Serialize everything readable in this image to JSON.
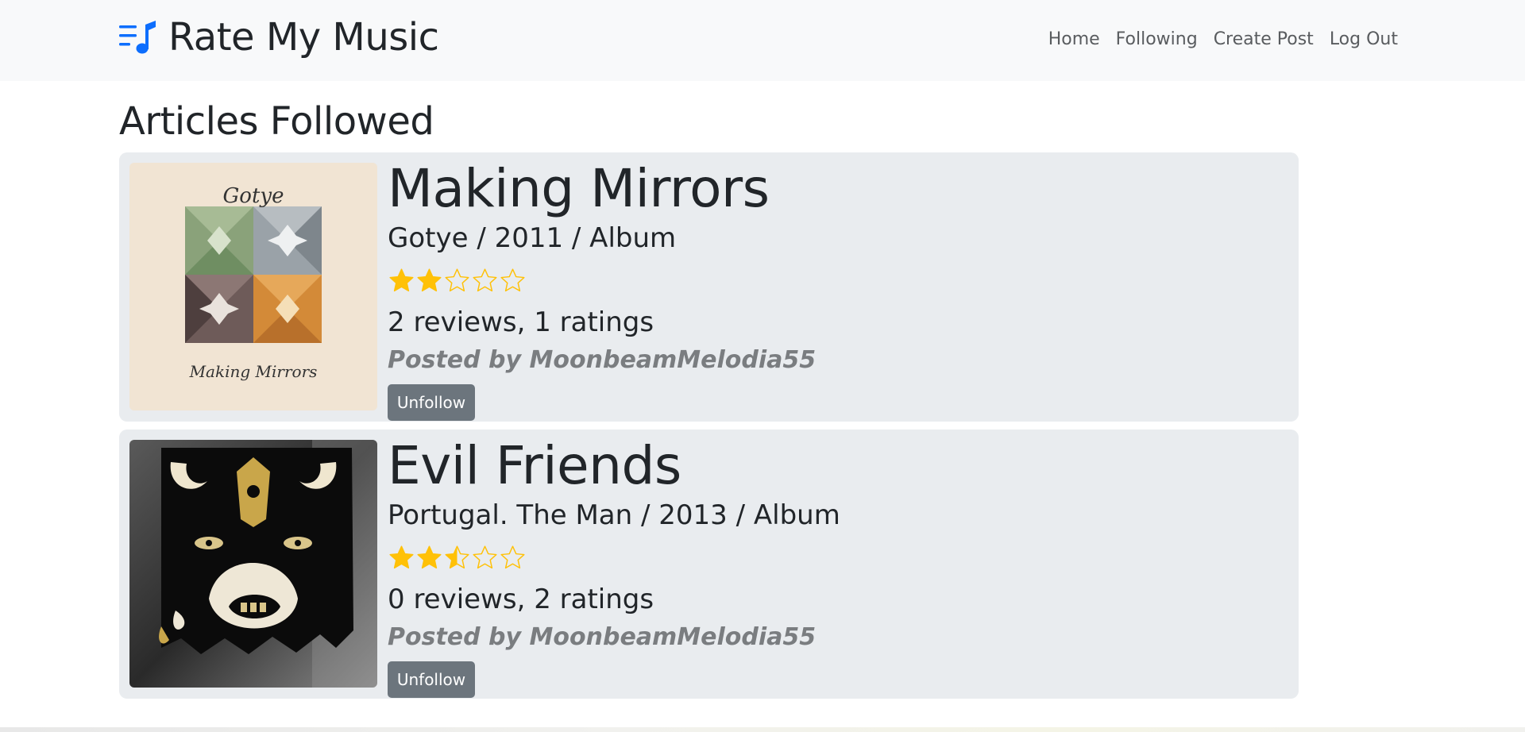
{
  "brand": {
    "name": "Rate My Music",
    "accent": "#0d6efd"
  },
  "nav": {
    "items": [
      {
        "label": "Home"
      },
      {
        "label": "Following"
      },
      {
        "label": "Create Post"
      },
      {
        "label": "Log Out"
      }
    ]
  },
  "page": {
    "title": "Articles Followed"
  },
  "articles": [
    {
      "title": "Making Mirrors",
      "meta": "Gotye / 2011 / Album",
      "rating": 2,
      "rating_max": 5,
      "stats": "2 reviews, 1 ratings",
      "posted_by": "Posted by MoonbeamMelodia55",
      "button": "Unfollow",
      "cover_text": {
        "top": "Gotye",
        "bottom": "Making Mirrors"
      }
    },
    {
      "title": "Evil Friends",
      "meta": "Portugal. The Man / 2013 / Album",
      "rating": 2.5,
      "rating_max": 5,
      "stats": "0 reviews, 2 ratings",
      "posted_by": "Posted by MoonbeamMelodia55",
      "button": "Unfollow"
    }
  ],
  "colors": {
    "star": "#ffc107",
    "button": "#6c757d",
    "card": "#e9ecef",
    "navbar": "#f8f9fa"
  }
}
